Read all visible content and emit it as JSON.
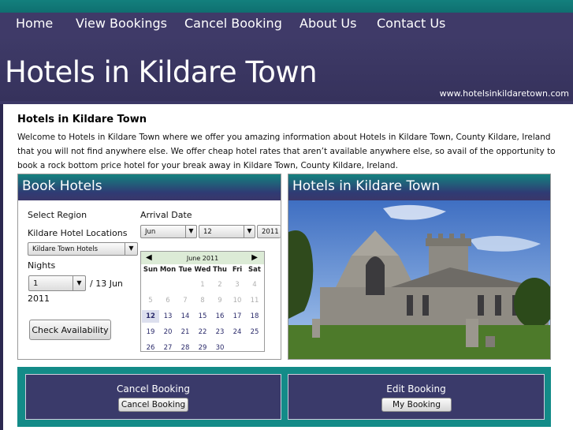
{
  "nav": {
    "items": [
      "Home",
      "View Bookings",
      "Cancel Booking",
      "About Us",
      "Contact Us"
    ]
  },
  "site": {
    "title": "Hotels in Kildare Town",
    "url": "www.hotelsinkildaretown.com"
  },
  "main": {
    "heading": "Hotels in Kildare Town",
    "intro": "Welcome to Hotels in Kildare Town where we offer you amazing information about Hotels in Kildare Town, County Kildare, Ireland that you will not find anywhere else. We offer cheap hotel rates that aren’t available anywhere else, so avail of the opportunity to book a rock bottom price hotel for your break away in Kildare Town, County Kildare, Ireland."
  },
  "booking": {
    "panel_title": "Book Hotels",
    "region_label": "Select Region",
    "locations_label": "Kildare Hotel Locations",
    "location_value": "Kildare Town Hotels",
    "arrival_label": "Arrival Date",
    "month_value": "Jun",
    "day_value": "12",
    "year_value": "2011",
    "nights_label": "Nights",
    "nights_value": "1",
    "checkout_text": "/ 13 Jun",
    "checkout_year": "2011",
    "check_button": "Check Availability"
  },
  "calendar": {
    "month_label": "June 2011",
    "days_of_week": [
      "Sun",
      "Mon",
      "Tue",
      "Wed",
      "Thu",
      "Fri",
      "Sat"
    ],
    "weeks": [
      [
        "",
        "",
        "",
        "1",
        "2",
        "3",
        "4"
      ],
      [
        "5",
        "6",
        "7",
        "8",
        "9",
        "10",
        "11"
      ],
      [
        "12",
        "13",
        "14",
        "15",
        "16",
        "17",
        "18"
      ],
      [
        "19",
        "20",
        "21",
        "22",
        "23",
        "24",
        "25"
      ],
      [
        "26",
        "27",
        "28",
        "29",
        "30",
        "",
        ""
      ]
    ],
    "selected_day": "12",
    "first_enabled_day": 12
  },
  "photo_panel": {
    "title": "Hotels in Kildare Town"
  },
  "bottom": {
    "cancel_title": "Cancel Booking",
    "cancel_button": "Cancel Booking",
    "edit_title": "Edit Booking",
    "edit_button": "My Booking"
  },
  "colors": {
    "nav_bg": "#3f3a68",
    "accent_teal": "#138b88",
    "panel_dark": "#3a3a6a"
  }
}
